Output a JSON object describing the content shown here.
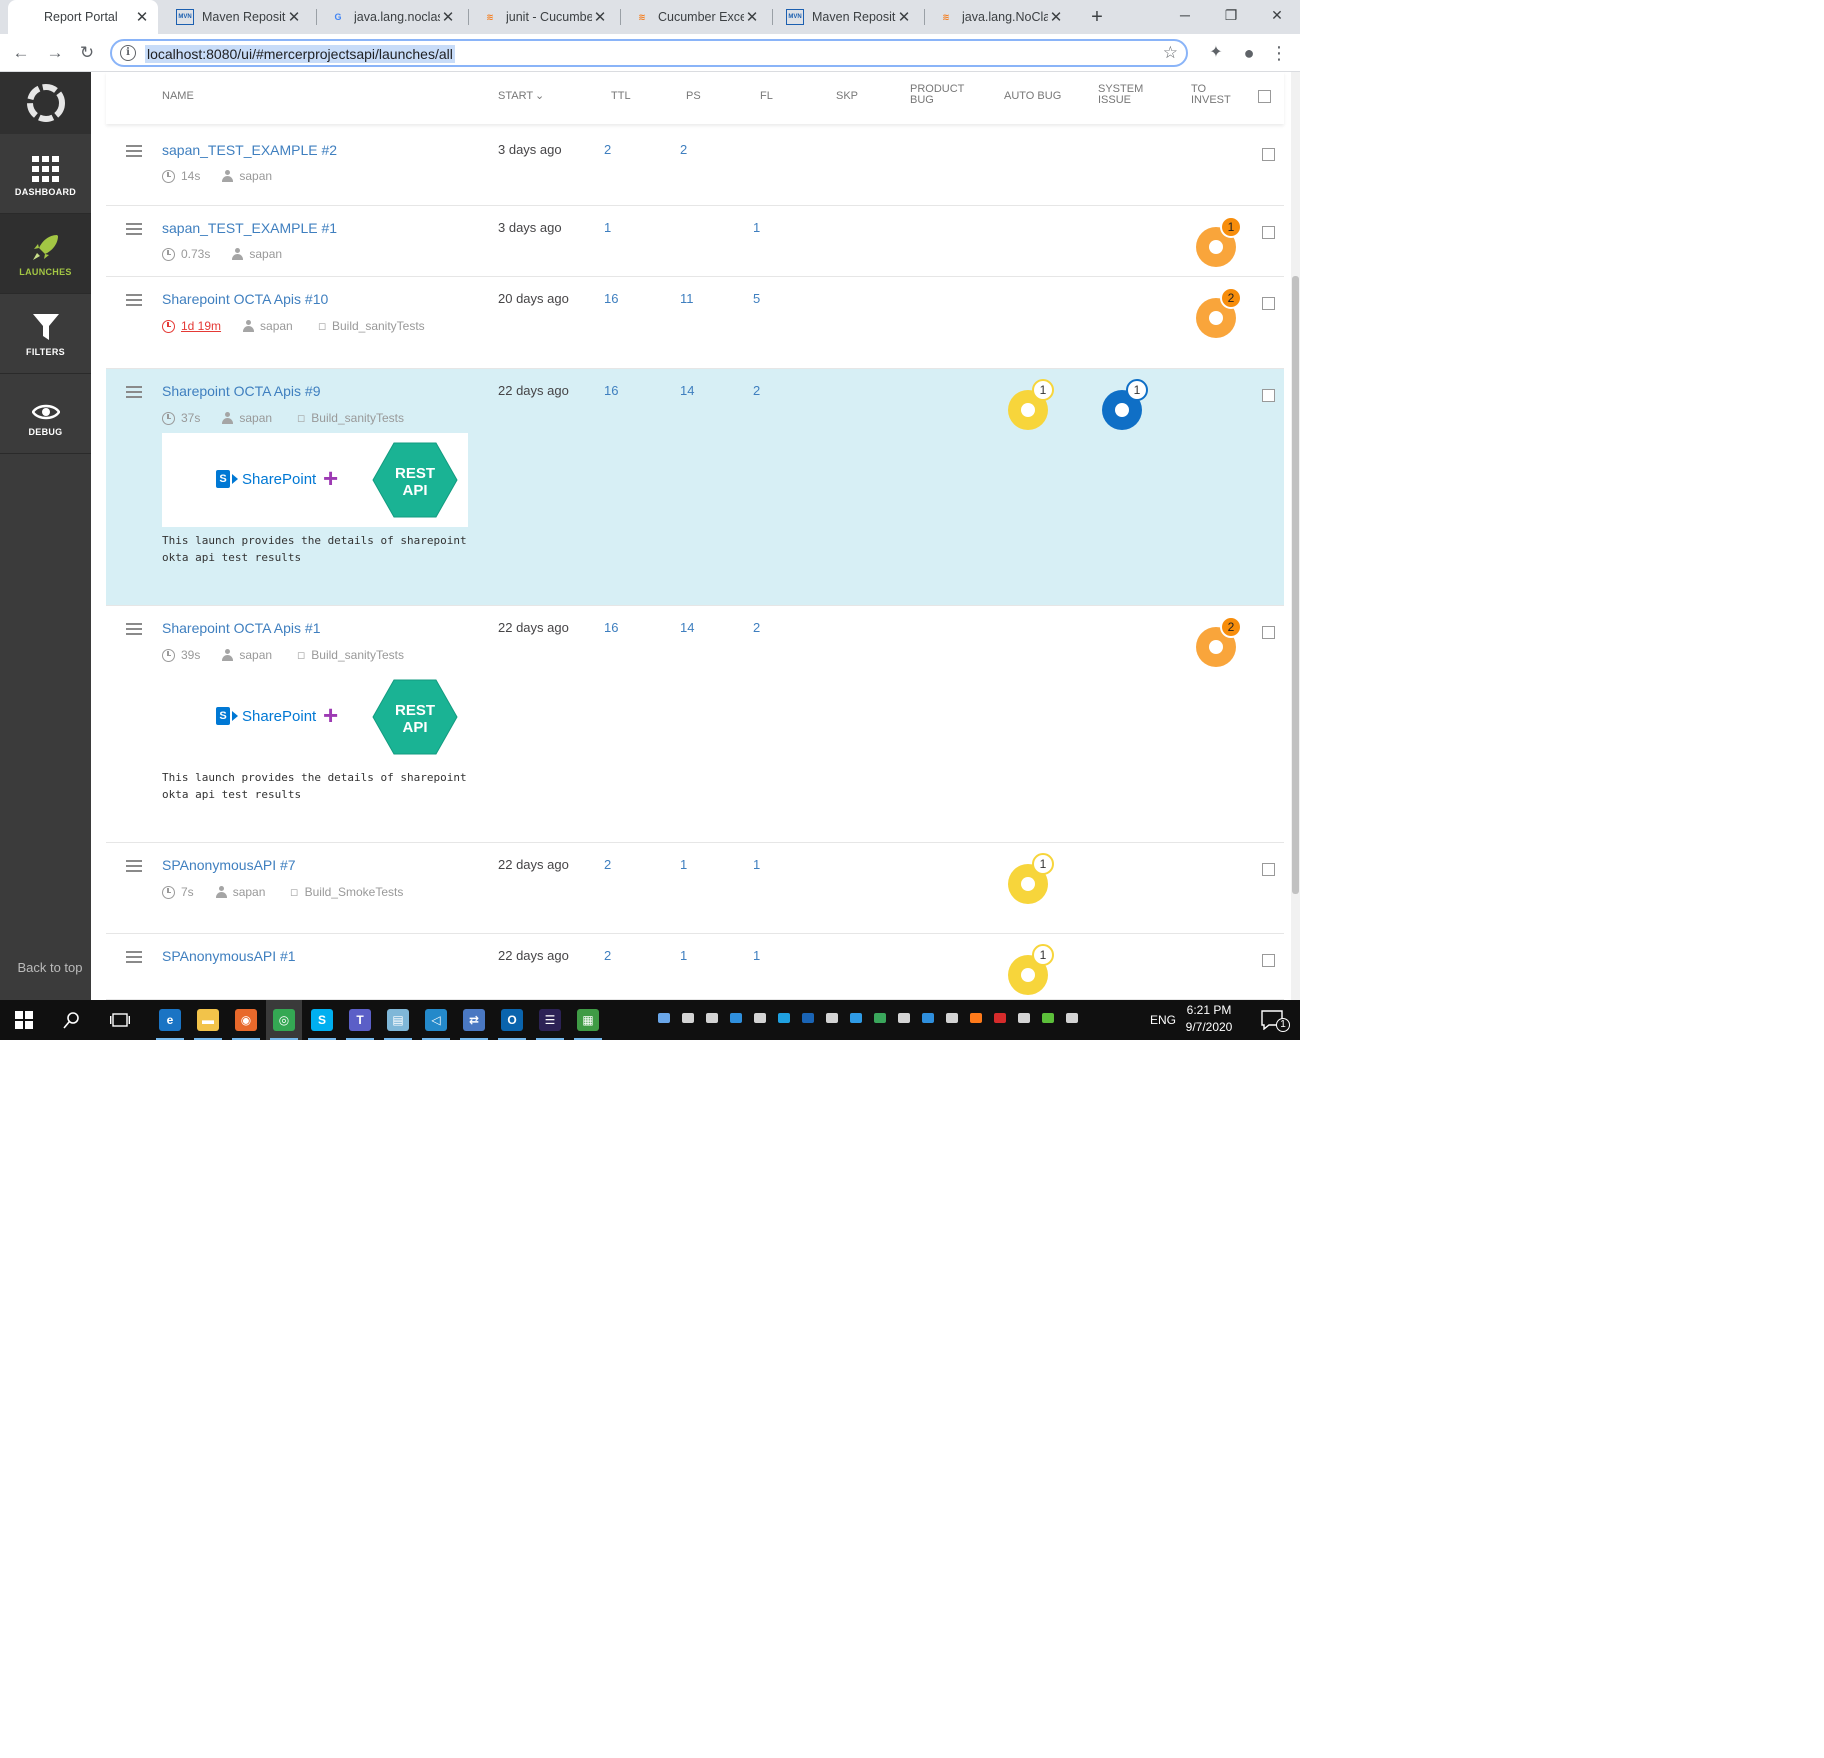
{
  "browser": {
    "tabs": [
      {
        "title": "Report Portal",
        "icon": "reportportal-icon",
        "favicon_text": "",
        "color": "#3c4043",
        "active": true
      },
      {
        "title": "Maven Reposito",
        "icon": "maven-icon",
        "favicon_text": "MVN",
        "color": "#1b5fb0",
        "active": false
      },
      {
        "title": "java.lang.noclas",
        "icon": "google-icon",
        "favicon_text": "G",
        "color": "#4285f4",
        "active": false
      },
      {
        "title": "junit - Cucumbe",
        "icon": "stackoverflow-icon",
        "favicon_text": "≋",
        "color": "#f48024",
        "active": false
      },
      {
        "title": "Cucumber Excep",
        "icon": "stackoverflow-icon",
        "favicon_text": "≋",
        "color": "#f48024",
        "active": false
      },
      {
        "title": "Maven Reposito",
        "icon": "maven-icon",
        "favicon_text": "MVN",
        "color": "#1b5fb0",
        "active": false
      },
      {
        "title": "java.lang.NoCla",
        "icon": "stackoverflow-icon",
        "favicon_text": "≋",
        "color": "#f48024",
        "active": false
      }
    ],
    "close_glyph": "✕",
    "new_tab": "+",
    "window_controls": {
      "minimize": "─",
      "restore": "❐",
      "close": "✕"
    },
    "nav": {
      "back": "←",
      "forward": "→",
      "reload": "↻"
    },
    "url": "localhost:8080/ui/#mercerprojectsapi/launches/all",
    "info_glyph": "i",
    "bookmark_glyph": "☆",
    "toolbar_icons": {
      "extensions": "✦",
      "profile": "●",
      "menu": "⋮"
    }
  },
  "sidebar": {
    "items": [
      {
        "label": "DASHBOARD",
        "icon": "dashboard-icon"
      },
      {
        "label": "LAUNCHES",
        "icon": "rocket-icon",
        "active": true
      },
      {
        "label": "FILTERS",
        "icon": "filter-icon"
      },
      {
        "label": "DEBUG",
        "icon": "eye-icon"
      }
    ],
    "back_to_top": "Back to top"
  },
  "table": {
    "columns": {
      "name": "NAME",
      "start": "START",
      "sort_glyph": "⌄",
      "ttl": "TTL",
      "ps": "PS",
      "fl": "FL",
      "skp": "SKP",
      "product_bug": [
        "PRODUCT",
        "BUG"
      ],
      "auto_bug": "AUTO BUG",
      "system_issue": [
        "SYSTEM",
        "ISSUE"
      ],
      "to_invest": [
        "TO",
        "INVEST"
      ]
    },
    "rows": [
      {
        "name": "sapan_TEST_EXAMPLE #2",
        "duration": "14s",
        "owner": "sapan",
        "tag": "",
        "start": "3 days ago",
        "ttl": "2",
        "ps": "2",
        "fl": ""
      },
      {
        "name": "sapan_TEST_EXAMPLE #1",
        "duration": "0.73s",
        "owner": "sapan",
        "tag": "",
        "start": "3 days ago",
        "ttl": "1",
        "ps": "",
        "fl": "1",
        "to_invest": "1"
      },
      {
        "name": "Sharepoint OCTA Apis #10",
        "duration": "1d 19m",
        "owner": "sapan",
        "tag": "Build_sanityTests",
        "start": "20 days ago",
        "ttl": "16",
        "ps": "11",
        "fl": "5",
        "to_invest": "2",
        "duration_exceeded": true
      },
      {
        "name": "Sharepoint OCTA Apis #9",
        "duration": "37s",
        "owner": "sapan",
        "tag": "Build_sanityTests",
        "start": "22 days ago",
        "ttl": "16",
        "ps": "14",
        "fl": "2",
        "auto_bug": "1",
        "system_issue": "1",
        "highlighted": true,
        "banner": {
          "sharepoint": "SharePoint",
          "sp_letter": "S",
          "plus": "+",
          "rest_line1": "REST",
          "rest_line2": "API"
        },
        "description": [
          "This launch provides the details of sharepoint",
          "okta api test results"
        ]
      },
      {
        "name": "Sharepoint OCTA Apis #1",
        "duration": "39s",
        "owner": "sapan",
        "tag": "Build_sanityTests",
        "start": "22 days ago",
        "ttl": "16",
        "ps": "14",
        "fl": "2",
        "to_invest": "2",
        "banner": {
          "sharepoint": "SharePoint",
          "sp_letter": "S",
          "plus": "+",
          "rest_line1": "REST",
          "rest_line2": "API"
        },
        "description": [
          "This launch provides the details of sharepoint",
          "okta api test results"
        ]
      },
      {
        "name": "SPAnonymousAPI #7",
        "duration": "7s",
        "owner": "sapan",
        "tag": "Build_SmokeTests",
        "start": "22 days ago",
        "ttl": "2",
        "ps": "1",
        "fl": "1",
        "auto_bug": "1"
      },
      {
        "name": "SPAnonymousAPI #1",
        "duration": "",
        "owner": "",
        "tag": "",
        "start": "22 days ago",
        "ttl": "2",
        "ps": "1",
        "fl": "1",
        "auto_bug": "1"
      }
    ]
  },
  "colors": {
    "link": "#3f7fbf",
    "to_invest": "#f9a53b",
    "auto_bug": "#f7d53b",
    "system_issue": "#0f6fc6",
    "highlight_row": "#d7eff5",
    "sidebar_active": "#a3c644",
    "rest_api": "#1ab394"
  },
  "taskbar": {
    "start_icon": "windows-start-icon",
    "apps": [
      {
        "icon": "edge-icon",
        "glyph": "e",
        "color": "#1a74c4"
      },
      {
        "icon": "file-explorer-icon",
        "glyph": "▬",
        "color": "#f2c34a"
      },
      {
        "icon": "firefox-icon",
        "glyph": "◉",
        "color": "#e8692b"
      },
      {
        "icon": "chrome-icon",
        "glyph": "◎",
        "color": "#34a853"
      },
      {
        "icon": "skype-icon",
        "glyph": "S",
        "color": "#00aff0"
      },
      {
        "icon": "teams-icon",
        "glyph": "T",
        "color": "#5b5fc7"
      },
      {
        "icon": "notepad-icon",
        "glyph": "▤",
        "color": "#7fb7d8"
      },
      {
        "icon": "vscode-icon",
        "glyph": "◁",
        "color": "#2489ca"
      },
      {
        "icon": "network-icon",
        "glyph": "⇄",
        "color": "#4a78c2"
      },
      {
        "icon": "outlook-icon",
        "glyph": "O",
        "color": "#0a64ad"
      },
      {
        "icon": "eclipse-icon",
        "glyph": "☰",
        "color": "#2c2255"
      },
      {
        "icon": "chart-app-icon",
        "glyph": "▦",
        "color": "#3f9b45"
      }
    ],
    "tray_count": 18,
    "language": "ENG",
    "time": "6:21 PM",
    "date": "9/7/2020",
    "notifications": "1"
  }
}
